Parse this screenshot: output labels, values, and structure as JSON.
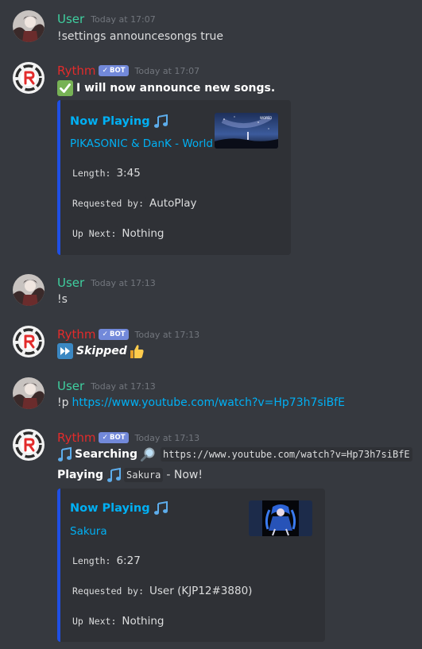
{
  "messages": [
    {
      "author": "User",
      "timestamp": "Today at 17:07",
      "text": "!settings announcesongs true"
    },
    {
      "author": "Rythm",
      "bot_badge": "BOT",
      "timestamp": "Today at 17:07",
      "text": "I will now announce new songs.",
      "embed": {
        "title": "Now Playing",
        "song": "PIKASONIC & DanK - World",
        "length_label": "Length:",
        "length": "3:45",
        "requested_label": "Requested by:",
        "requested_by": "AutoPlay",
        "upnext_label": "Up Next:",
        "up_next": "Nothing",
        "thumb_text": "WORLD"
      }
    },
    {
      "author": "User",
      "timestamp": "Today at 17:13",
      "text": "!s"
    },
    {
      "author": "Rythm",
      "bot_badge": "BOT",
      "timestamp": "Today at 17:13",
      "text": "Skipped"
    },
    {
      "author": "User",
      "timestamp": "Today at 17:13",
      "prefix": "!p",
      "link": "https://www.youtube.com/watch?v=Hp73h7siBfE"
    },
    {
      "author": "Rythm",
      "bot_badge": "BOT",
      "timestamp": "Today at 17:13",
      "searching_label": "Searching",
      "search_url": "https://www.youtube.com/watch?v=Hp73h7siBfE",
      "playing_label": "Playing",
      "playing_song": "Sakura",
      "playing_suffix": "- Now!",
      "embed": {
        "title": "Now Playing",
        "song": "Sakura",
        "length_label": "Length:",
        "length": "6:27",
        "requested_label": "Requested by:",
        "requested_by": "User (KJP12#3880)",
        "upnext_label": "Up Next:",
        "up_next": "Nothing"
      }
    }
  ],
  "colors": {
    "background": "#36393f",
    "embed_bg": "#2f3136",
    "embed_border": "#1f4fe5",
    "user_name": "#3fcf9f",
    "bot_name": "#e22b2b",
    "link": "#00b0f4",
    "badge": "#7289da"
  }
}
